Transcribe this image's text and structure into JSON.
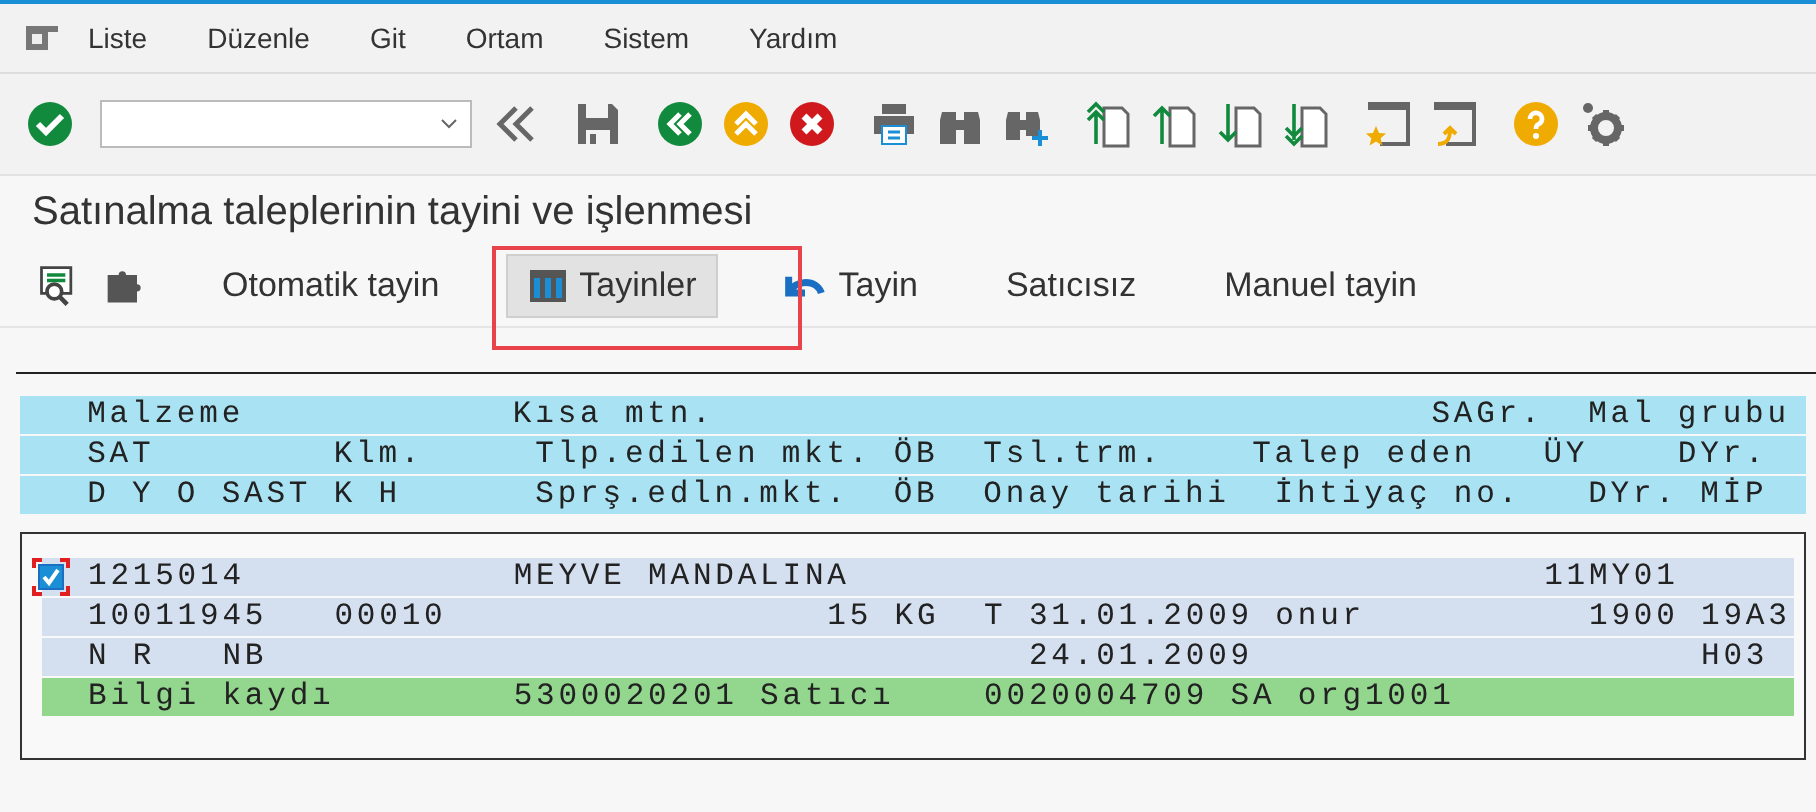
{
  "menu": [
    {
      "label": "Liste"
    },
    {
      "label": "Düzenle"
    },
    {
      "label": "Git"
    },
    {
      "label": "Ortam"
    },
    {
      "label": "Sistem"
    },
    {
      "label": "Yardım"
    }
  ],
  "title": "Satınalma taleplerinin tayini ve işlenmesi",
  "app_toolbar": [
    {
      "label": "Otomatik tayin",
      "kind": "plain",
      "selected": false,
      "highlighted": false
    },
    {
      "label": "Tayinler",
      "kind": "grid",
      "selected": true,
      "highlighted": true
    },
    {
      "label": "Tayin",
      "kind": "undo",
      "selected": false,
      "highlighted": false
    },
    {
      "label": "Satıcısız",
      "kind": "plain",
      "selected": false,
      "highlighted": false
    },
    {
      "label": "Manuel tayin",
      "kind": "plain",
      "selected": false,
      "highlighted": false
    }
  ],
  "list_header": [
    "   Malzeme            Kısa mtn.                                SAGr.  Mal grubu",
    "   SAT        Klm.     Tlp.edilen mkt. ÖB  Tsl.trm.    Talep eden   ÜY    DYr.",
    "   D Y O SAST K H      Sprş.edln.mkt.  ÖB  Onay tarihi  İhtiyaç no.   DYr. MİP"
  ],
  "list_rows": [
    {
      "kind": "item",
      "text": "1215014            MEYVE MANDALINA                               11MY01",
      "checkbox": {
        "checked": true,
        "focused": true
      }
    },
    {
      "kind": "item",
      "text": "10011945   00010                 15 KG  T 31.01.2009 onur          1900 19A3"
    },
    {
      "kind": "item",
      "text": "N R   NB                                  24.01.2009                    H03"
    },
    {
      "kind": "info",
      "text": "Bilgi kaydı        5300020201 Satıcı    0020004709 SA org1001"
    }
  ]
}
